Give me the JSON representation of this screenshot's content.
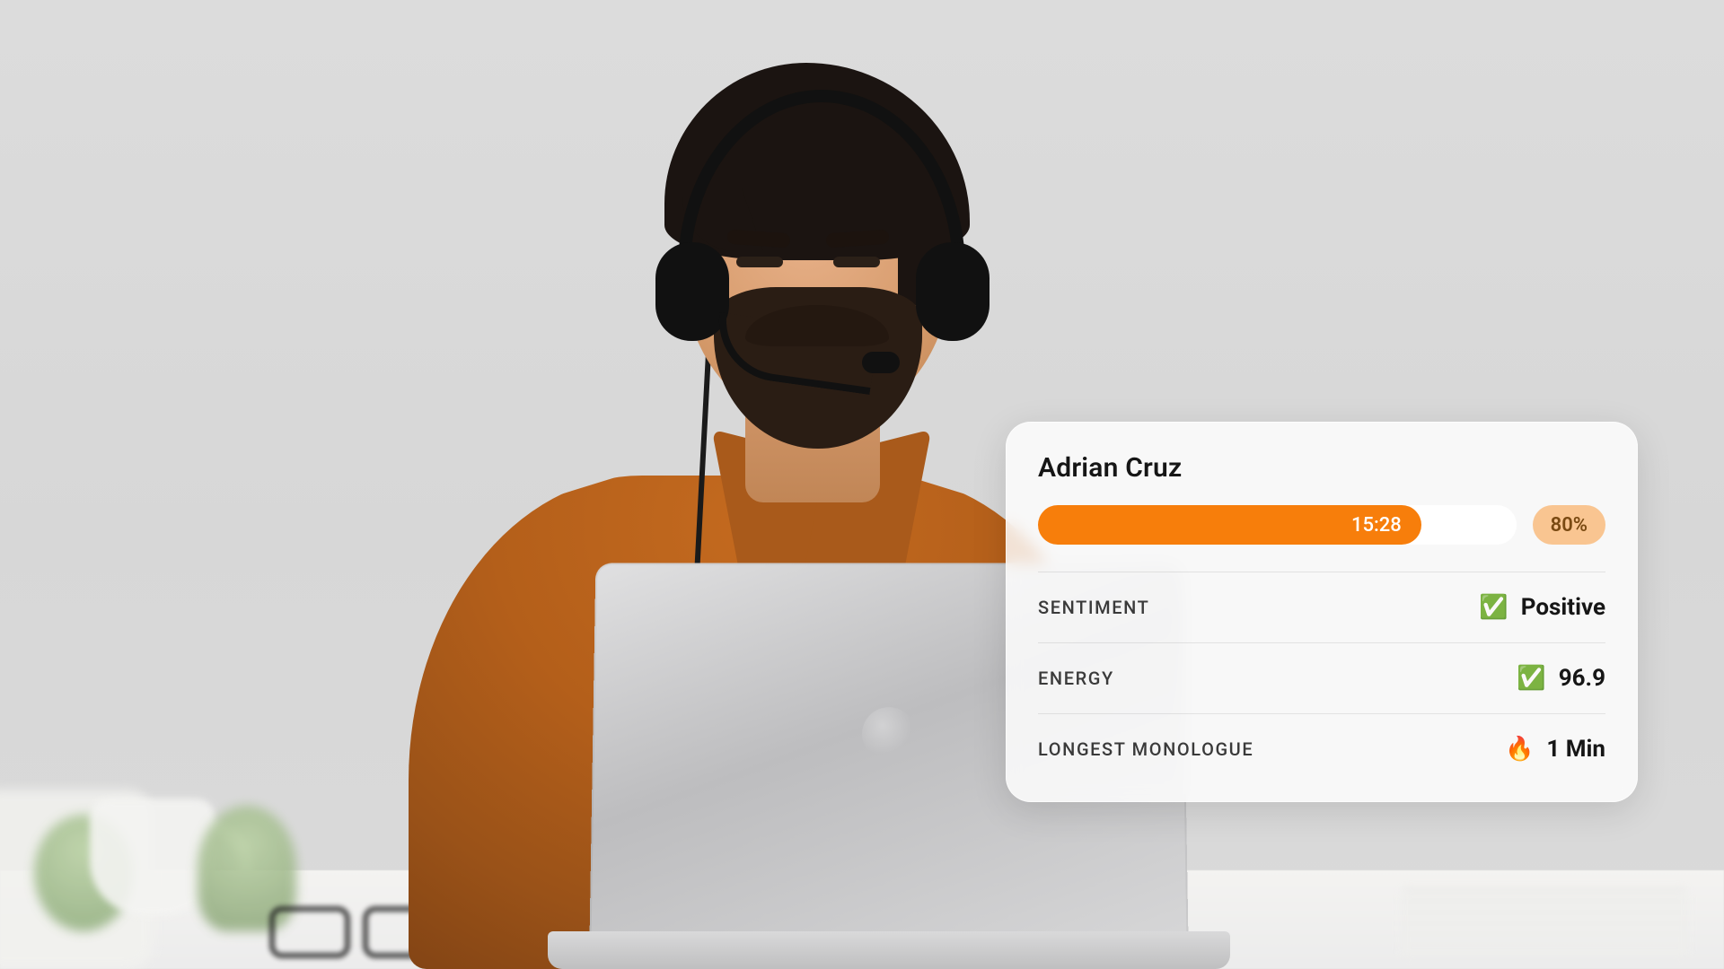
{
  "colors": {
    "accent_orange": "#f77e0b",
    "badge_bg": "#f9c591",
    "badge_text": "#7a4a12"
  },
  "agent": {
    "name": "Adrian Cruz"
  },
  "progress": {
    "elapsed_label": "15:28",
    "percent_label": "80%",
    "percent_value": 80
  },
  "metrics": [
    {
      "key": "sentiment",
      "label": "SENTIMENT",
      "icon": "✅",
      "value": "Positive"
    },
    {
      "key": "energy",
      "label": "ENERGY",
      "icon": "✅",
      "value": "96.9"
    },
    {
      "key": "longest_monologue",
      "label": "LONGEST MONOLOGUE",
      "icon": "🔥",
      "value": "1 Min"
    }
  ]
}
